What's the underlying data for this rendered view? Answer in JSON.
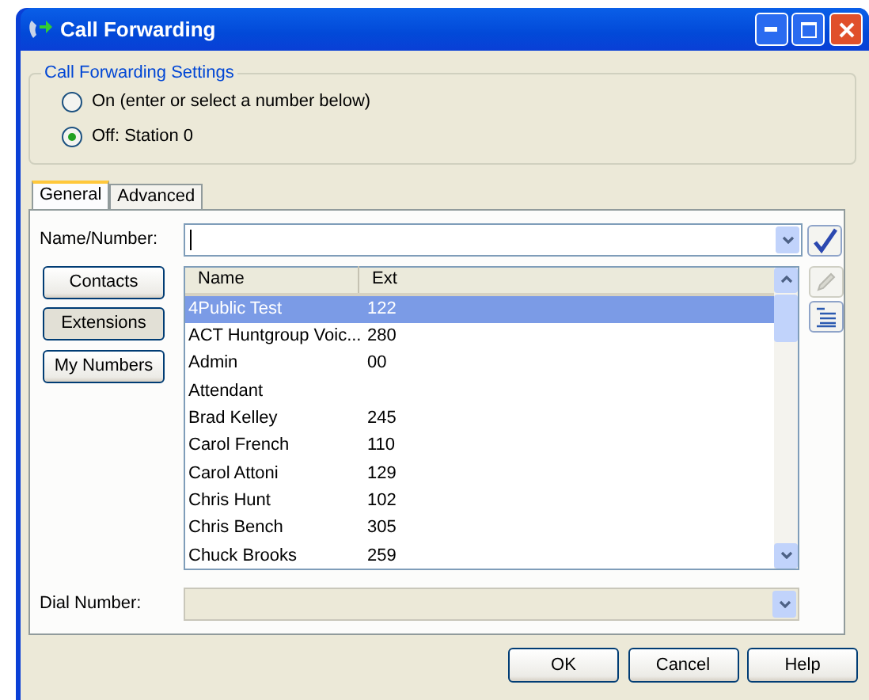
{
  "window": {
    "title": "Call Forwarding"
  },
  "settings": {
    "legend": "Call Forwarding Settings",
    "options": [
      {
        "label": "On (enter or select a number below)",
        "selected": false
      },
      {
        "label": "Off: Station 0",
        "selected": true
      }
    ]
  },
  "tabs": [
    {
      "label": "General",
      "selected": true
    },
    {
      "label": "Advanced",
      "selected": false
    }
  ],
  "name_number": {
    "label": "Name/Number:"
  },
  "sources": [
    {
      "label": "Contacts",
      "selected": false
    },
    {
      "label": "Extensions",
      "selected": true
    },
    {
      "label": "My Numbers",
      "selected": false
    }
  ],
  "table": {
    "columns": [
      "Name",
      "Ext"
    ],
    "rows": [
      {
        "name": "4Public Test",
        "ext": "122",
        "selected": true
      },
      {
        "name": "ACT Huntgroup Voic...",
        "ext": "280",
        "selected": false
      },
      {
        "name": "Admin",
        "ext": "00",
        "selected": false
      },
      {
        "name": "Attendant",
        "ext": "",
        "selected": false
      },
      {
        "name": "Brad Kelley",
        "ext": "245",
        "selected": false
      },
      {
        "name": "Carol French",
        "ext": "110",
        "selected": false
      },
      {
        "name": "Carol Attoni",
        "ext": "129",
        "selected": false
      },
      {
        "name": "Chris Hunt",
        "ext": "102",
        "selected": false
      },
      {
        "name": "Chris Bench",
        "ext": "305",
        "selected": false
      },
      {
        "name": "Chuck Brooks",
        "ext": "259",
        "selected": false
      }
    ]
  },
  "dial_number": {
    "label": "Dial Number:",
    "disabled": true
  },
  "buttons": [
    "OK",
    "Cancel",
    "Help"
  ]
}
